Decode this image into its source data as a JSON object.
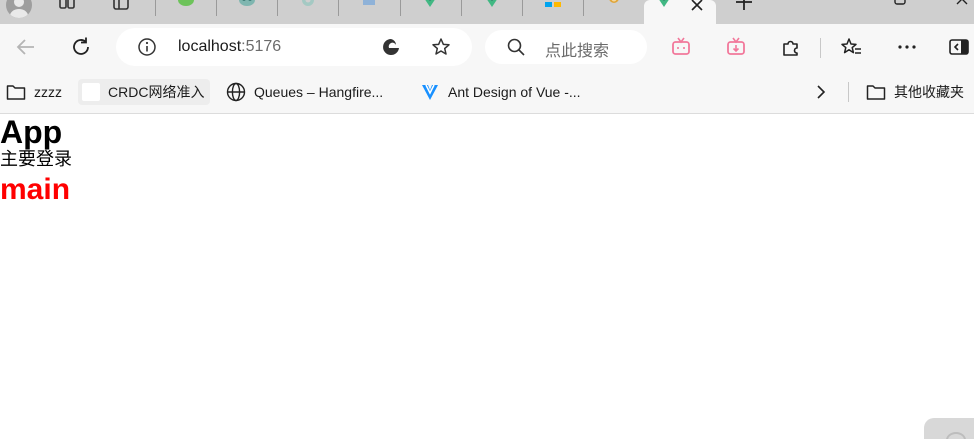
{
  "browser": {
    "address_bar": {
      "host": "localhost",
      "port": ":5176"
    },
    "search_box": {
      "placeholder": "点此搜索"
    },
    "bookmarks": [
      {
        "label": "zzzz"
      },
      {
        "label": "CRDC网络准入"
      },
      {
        "label": "Queues – Hangfire..."
      },
      {
        "label": "Ant Design of Vue -..."
      }
    ],
    "other_bookmarks_label": "其他收藏夹"
  },
  "page": {
    "app_heading": "App",
    "subtitle": "主要登录",
    "main_heading": "main"
  },
  "colors": {
    "main_heading": "#ff0000",
    "toolbar_bg": "#f7f7f7",
    "tabstrip_bg": "#cfcfcf",
    "vue_green": "#41b883",
    "vue_dark": "#35495e",
    "antd_blue": "#1890ff"
  },
  "icons": {
    "toolbar": [
      "back-arrow-icon",
      "refresh-icon",
      "info-icon",
      "edge-icon",
      "star-icon",
      "search-icon",
      "tv-icon",
      "download-tv-icon",
      "extensions-icon",
      "favorites-icon",
      "more-icon",
      "sidebar-icon"
    ],
    "bookmarks": [
      "folder-icon",
      "blank-favicon",
      "globe-icon",
      "antd-logo-icon",
      "chevron-right-icon",
      "folder-icon"
    ]
  }
}
